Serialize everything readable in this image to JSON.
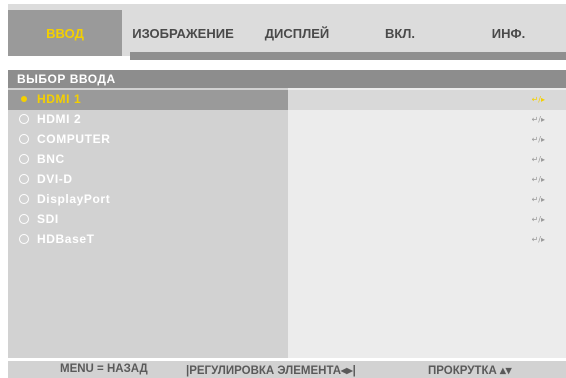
{
  "tabs": [
    {
      "label": "ВВОД",
      "active": true
    },
    {
      "label": "ИЗОБРАЖЕНИЕ",
      "active": false
    },
    {
      "label": "ДИСПЛЕЙ",
      "active": false
    },
    {
      "label": "ВКЛ.",
      "active": false
    },
    {
      "label": "ИНФ.",
      "active": false
    }
  ],
  "section": {
    "title": "ВЫБОР ВВОДА"
  },
  "inputs": [
    {
      "label": "HDMI 1",
      "selected": true,
      "icon": "enter-right-icon"
    },
    {
      "label": "HDMI 2",
      "selected": false,
      "icon": "enter-right-icon"
    },
    {
      "label": "COMPUTER",
      "selected": false,
      "icon": "enter-right-icon"
    },
    {
      "label": "BNC",
      "selected": false,
      "icon": "enter-right-icon"
    },
    {
      "label": "DVI-D",
      "selected": false,
      "icon": "enter-right-icon"
    },
    {
      "label": "DisplayPort",
      "selected": false,
      "icon": "enter-right-icon"
    },
    {
      "label": "SDI",
      "selected": false,
      "icon": "enter-right-icon"
    },
    {
      "label": "HDBaseT",
      "selected": false,
      "icon": "enter-right-icon"
    }
  ],
  "footer": {
    "back": "MENU = НАЗАД",
    "adjust": "|РЕГУЛИРОВКА ЭЛЕМЕНТА◂▸|",
    "scroll": "ПРОКРУТКА ▴▾"
  },
  "colors": {
    "accent": "#f4d000",
    "header_bg": "#8d8d8d",
    "selected_bg": "#9a9a9a",
    "panel_left": "#d2d2d2",
    "panel_right": "#ececec"
  }
}
